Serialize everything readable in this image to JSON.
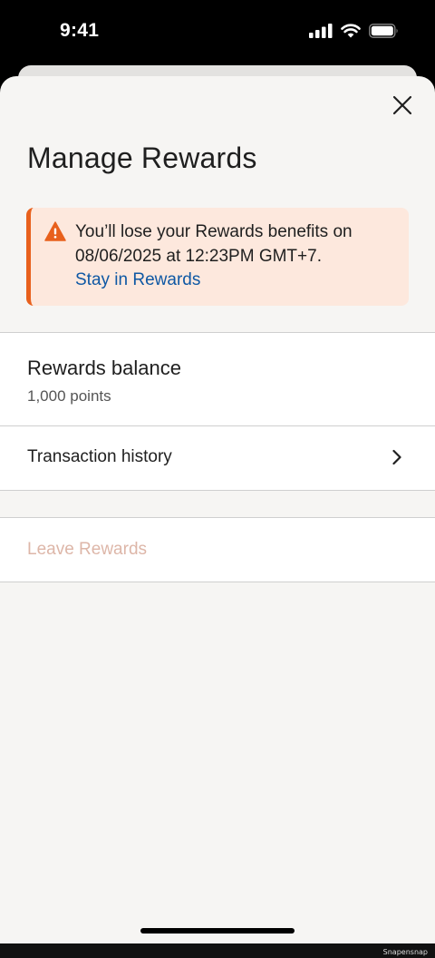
{
  "status_bar": {
    "time": "9:41",
    "icons": [
      "cellular-signal-icon",
      "wifi-icon",
      "battery-icon"
    ]
  },
  "sheet": {
    "close_icon": "close-icon",
    "title": "Manage Rewards"
  },
  "alert": {
    "icon": "warning-icon",
    "message": "You’ll lose your Rewards benefits on 08/06/2025 at 12:23PM GMT+7.",
    "link": "Stay in Rewards",
    "accent_color": "#e8601c",
    "background_color": "#fde8dd",
    "link_color": "#0f58a4"
  },
  "balance": {
    "title": "Rewards balance",
    "value": "1,000 points"
  },
  "history": {
    "label": "Transaction history",
    "icon": "chevron-right-icon"
  },
  "leave": {
    "label": "Leave Rewards",
    "color": "#ddb6a8"
  },
  "footer": {
    "watermark": "Snapensnap"
  }
}
